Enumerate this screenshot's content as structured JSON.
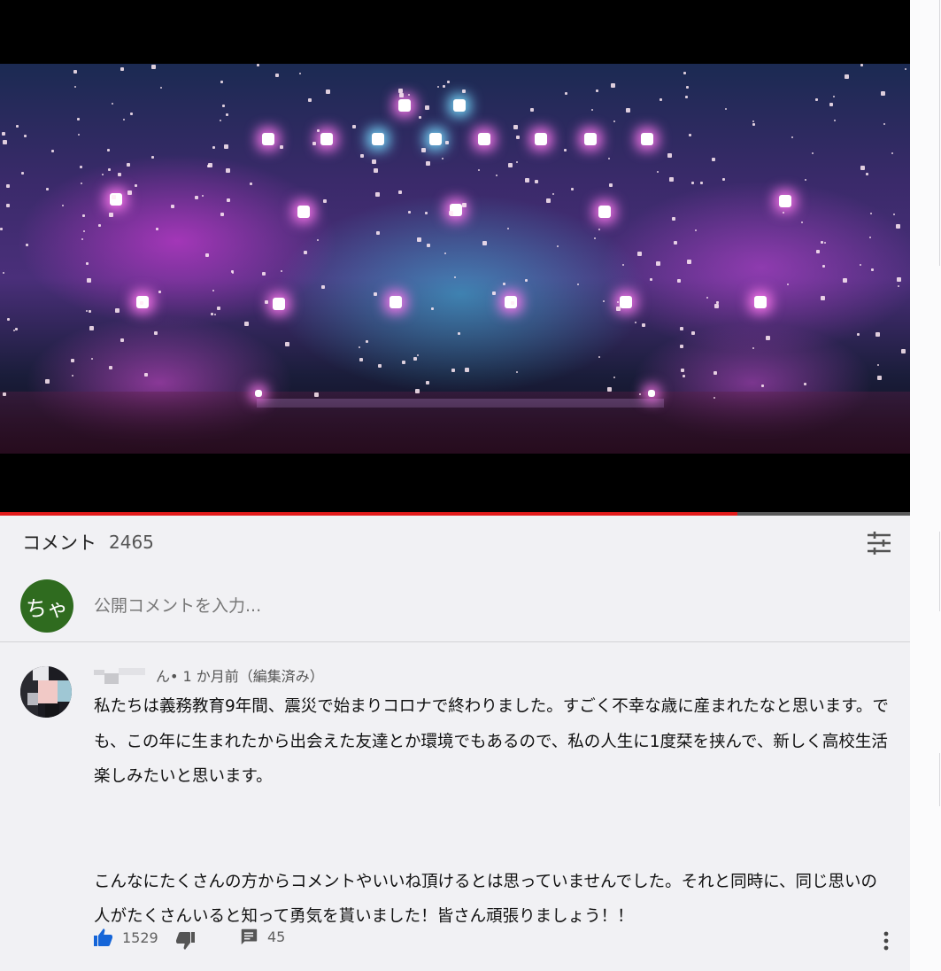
{
  "video": {
    "progress_percent": 81
  },
  "comments": {
    "title": "コメント",
    "count": "2465",
    "sort_icon": "sort-sliders-icon"
  },
  "add_comment": {
    "avatar_text": "ちゃ",
    "avatar_color": "#2f6b1f",
    "placeholder": "公開コメントを入力..."
  },
  "comment": {
    "author_visible_suffix": "ん",
    "meta": " • 1 か月前（編集済み）",
    "paragraphs": [
      "私たちは義務教育9年間、震災で始まりコロナで終わりました。すごく不幸な歳に産まれたなと思います。でも、この年に生まれたから出会えた友達とか環境でもあるので、私の人生に1度栞を挟んで、新しく高校生活楽しみたいと思います。",
      "こんなにたくさんの方からコメントやいいね頂けるとは思っていませんでした。それと同時に、同じ思いの人がたくさんいると知って勇気を貰いました！皆さん頑張りましょう！！"
    ],
    "likes": "1529",
    "replies": "45",
    "like_color": "#1565d8"
  }
}
